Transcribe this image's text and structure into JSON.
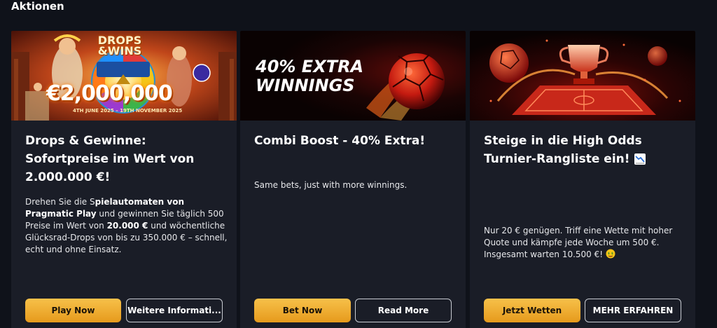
{
  "section": {
    "title": "Aktionen"
  },
  "cards": [
    {
      "banner": {
        "headline": "DROPS\n&WINS",
        "amount": "€2,000,000",
        "dates": "4TH JUNE 2025 – 19TH NOVEMBER 2025"
      },
      "title": "Drops & Gewinne: Sofortpreise im Wert von 2.000.000 €!",
      "desc_parts": [
        "Drehen Sie die S",
        "pielautomaten von Pragmatic Play",
        " und gewinnen Sie täglich 500 Preise im Wert von ",
        "20.000 €",
        " und wöchentliche Glücksrad-Drops von bis zu 350.000 € – schnell, echt und ohne Einsatz."
      ],
      "primary_label": "Play Now",
      "secondary_label": "Weitere Informati..."
    },
    {
      "banner": {
        "headline": "40% EXTRA\nWINNINGS"
      },
      "title": "Combi Boost - 40% Extra!",
      "desc": "Same bets, just with more winnings.",
      "primary_label": "Bet Now",
      "secondary_label": "Read More"
    },
    {
      "title": "Steige in die High Odds Turnier-Rangliste ein!",
      "title_icon": "chart-decreasing-icon",
      "desc": "Nur 20 € genügen. Triff eine Wette mit hoher Quote und kämpfe jede Woche um 500 €. Insgesamt warten 10.500 €!",
      "desc_icon": "money-face-icon",
      "primary_label": "Jetzt Wetten",
      "secondary_label": "MEHR ERFAHREN"
    }
  ],
  "colors": {
    "page_bg": "#0f121a",
    "card_bg": "#1a1d27",
    "primary_btn": "#f0ad32",
    "accent_red": "#e0201a"
  }
}
